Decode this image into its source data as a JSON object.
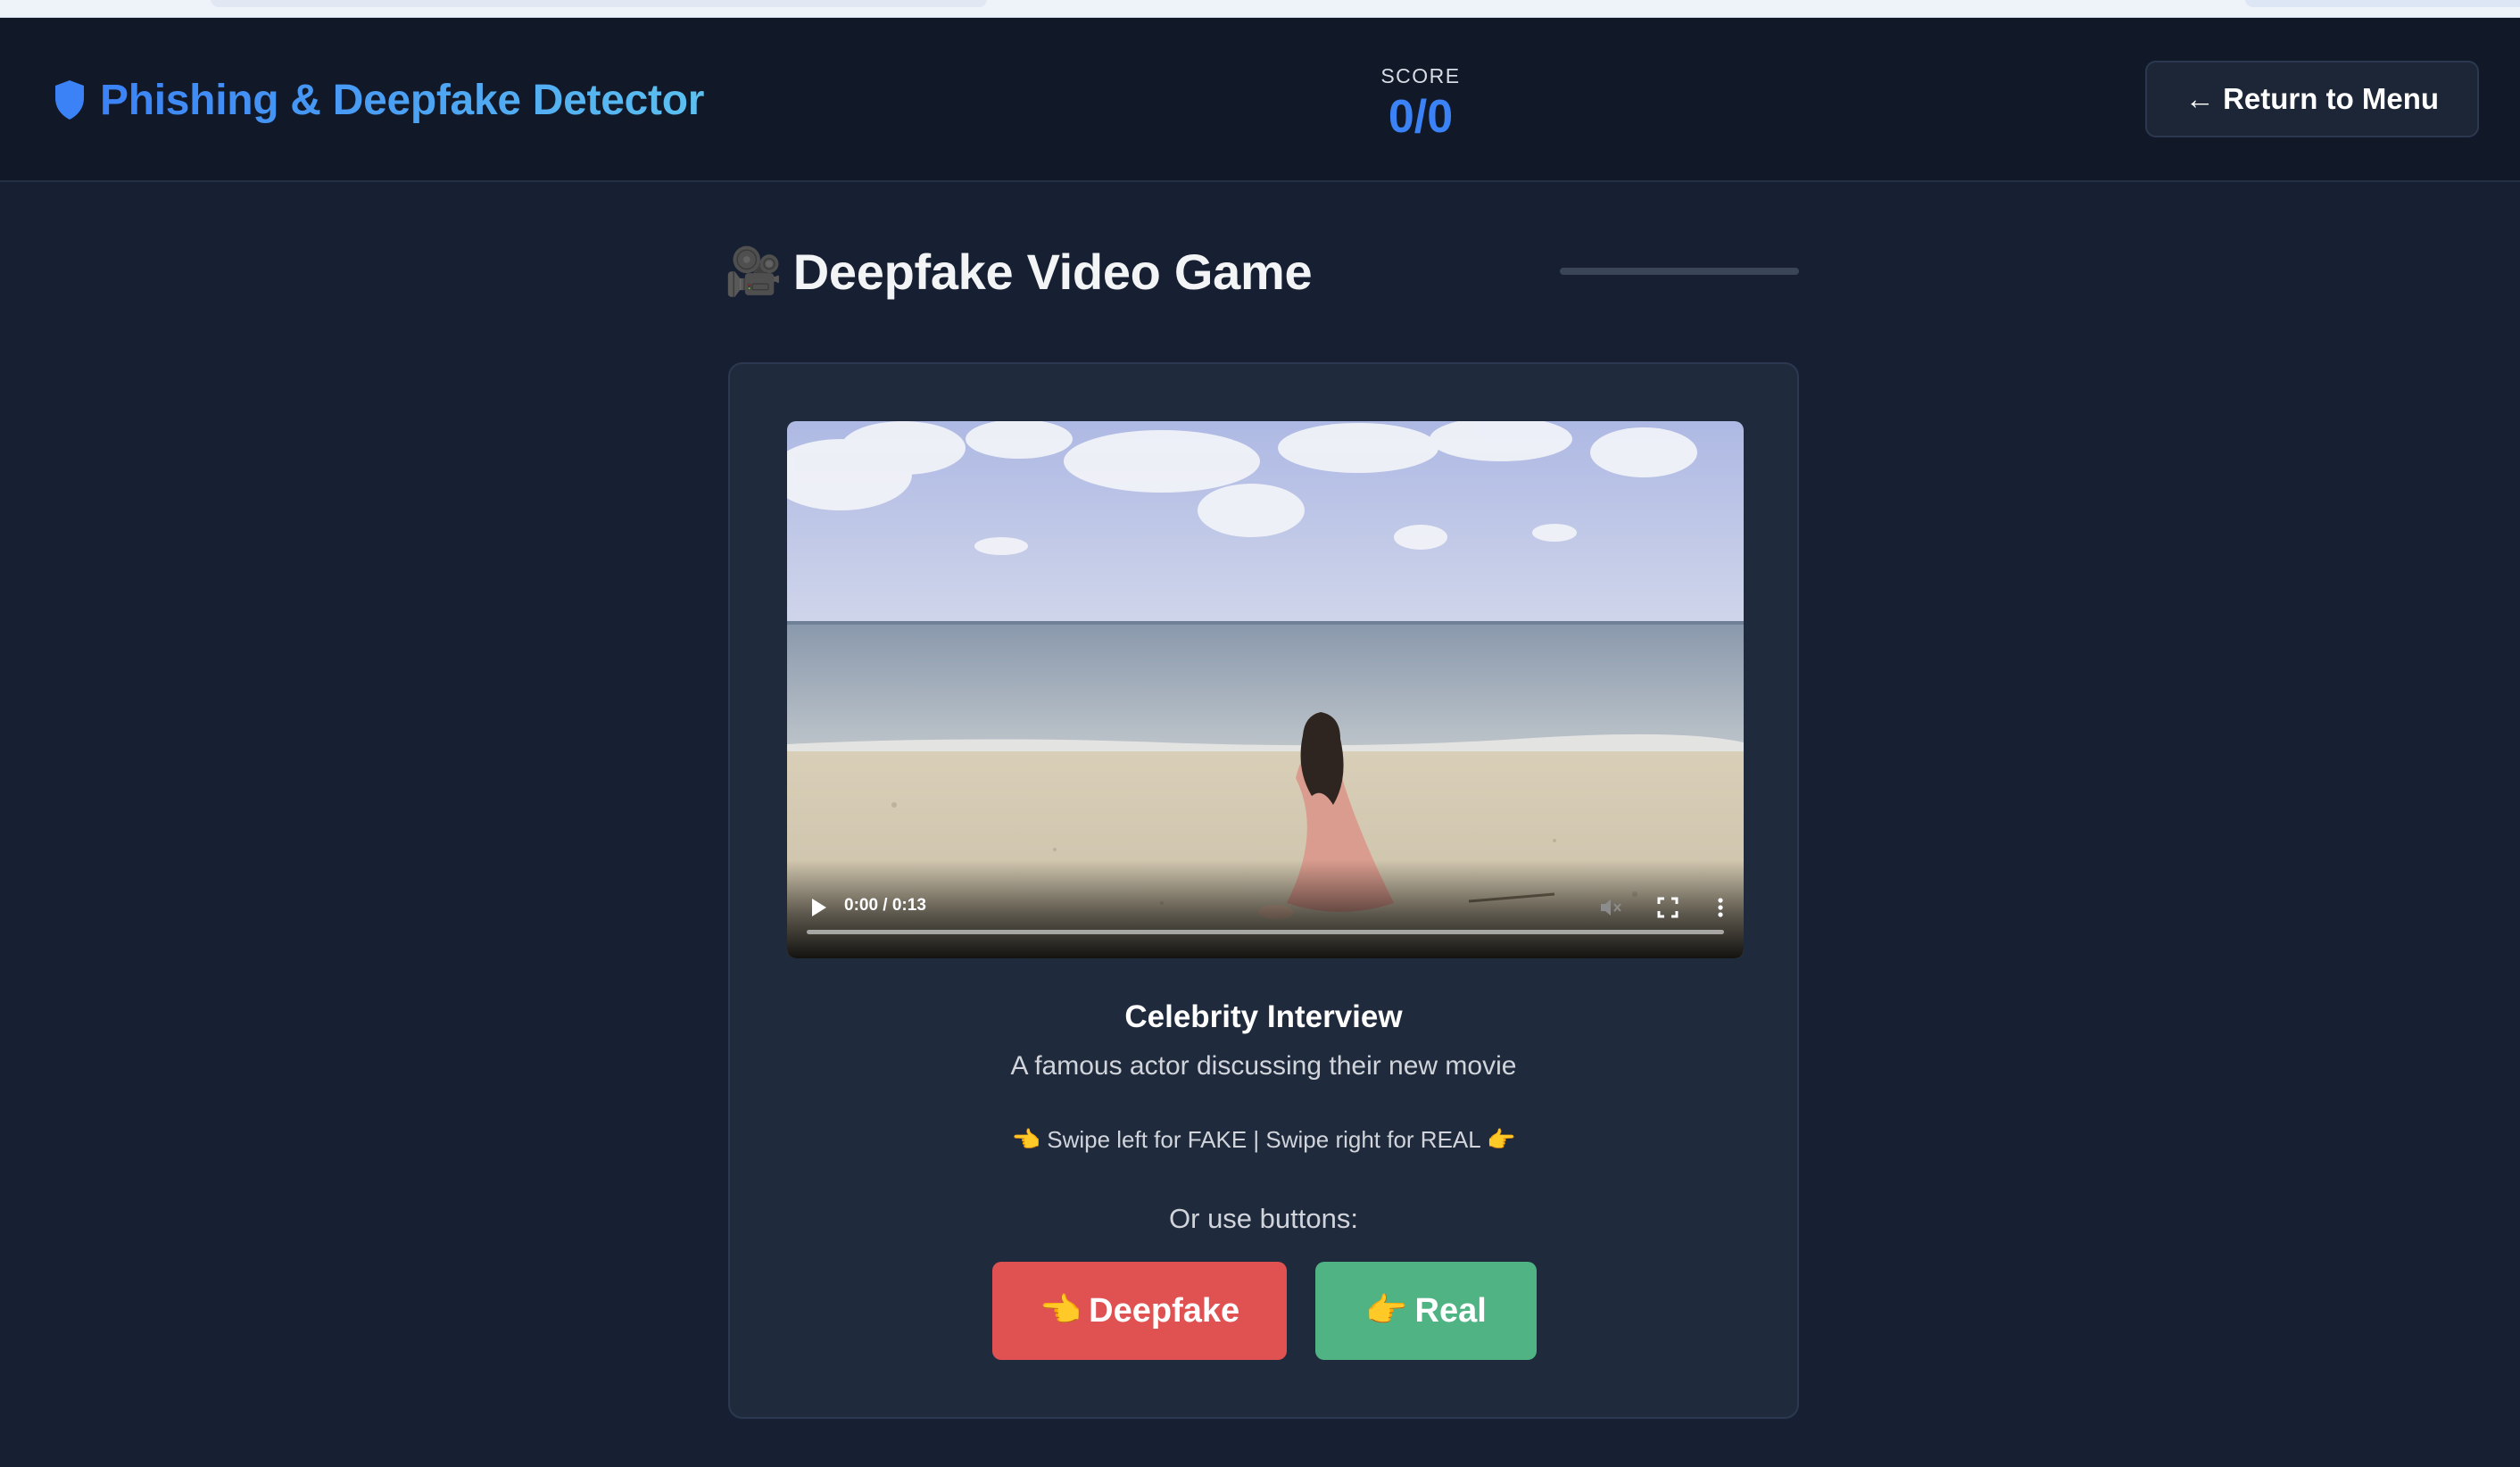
{
  "header": {
    "brand_title": "Phishing & Deepfake Detector",
    "brand_icon": "shield-icon",
    "score_label": "SCORE",
    "score_value": "0/0",
    "menu_button": "← Return to Menu"
  },
  "game": {
    "title_icon": "🎥",
    "title": "Deepfake Video Game",
    "progress_fraction": 0
  },
  "video": {
    "time": "0:00 / 0:13",
    "icons": [
      "play-icon",
      "volume-muted-icon",
      "fullscreen-icon",
      "more-options-icon"
    ]
  },
  "clip": {
    "title": "Celebrity Interview",
    "description": "A famous actor discussing their new movie"
  },
  "instructions": {
    "swipe_hint": "👈 Swipe left for FAKE | Swipe right for REAL 👉",
    "or_use": "Or use buttons:"
  },
  "buttons": {
    "fake_icon": "👈",
    "fake_label": "Deepfake",
    "real_icon": "👉",
    "real_label": "Real"
  },
  "colors": {
    "accent": "#3b82f6",
    "fake": "#e05252",
    "real": "#4fb383",
    "background": "#172033",
    "header": "#111828",
    "card": "#1f2a3c"
  }
}
